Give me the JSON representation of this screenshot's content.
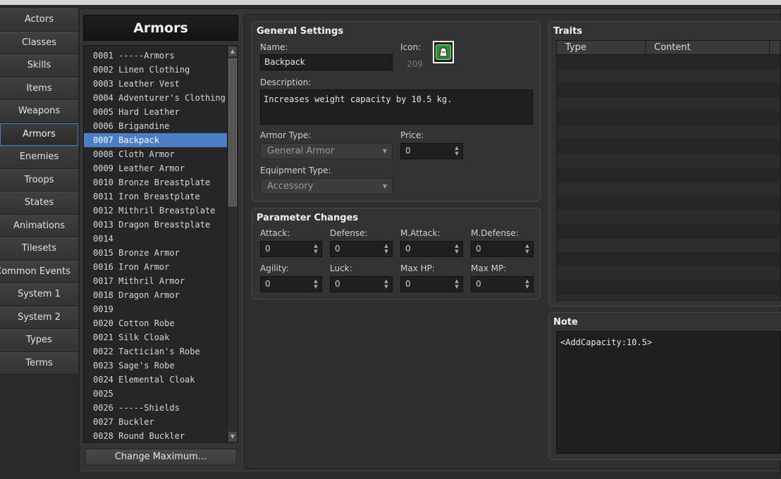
{
  "tabs": [
    {
      "label": "Actors"
    },
    {
      "label": "Classes"
    },
    {
      "label": "Skills"
    },
    {
      "label": "Items"
    },
    {
      "label": "Weapons"
    },
    {
      "label": "Armors"
    },
    {
      "label": "Enemies"
    },
    {
      "label": "Troops"
    },
    {
      "label": "States"
    },
    {
      "label": "Animations"
    },
    {
      "label": "Tilesets"
    },
    {
      "label": "Common Events"
    },
    {
      "label": "System 1"
    },
    {
      "label": "System 2"
    },
    {
      "label": "Types"
    },
    {
      "label": "Terms"
    }
  ],
  "list": {
    "title": "Armors",
    "items": [
      "0001 -----Armors",
      "0002 Linen Clothing",
      "0003 Leather Vest",
      "0004 Adventurer's Clothing",
      "0005 Hard Leather",
      "0006 Brigandine",
      "0007 Backpack",
      "0008 Cloth Armor",
      "0009 Leather Armor",
      "0010 Bronze Breastplate",
      "0011 Iron Breastplate",
      "0012 Mithril Breastplate",
      "0013 Dragon Breastplate",
      "0014",
      "0015 Bronze Armor",
      "0016 Iron Armor",
      "0017 Mithril Armor",
      "0018 Dragon Armor",
      "0019",
      "0020 Cotton Robe",
      "0021 Silk Cloak",
      "0022 Tactician's Robe",
      "0023 Sage's Robe",
      "0024 Elemental Cloak",
      "0025",
      "0026 -----Shields",
      "0027 Buckler",
      "0028 Round Buckler"
    ],
    "change_max_label": "Change Maximum..."
  },
  "general": {
    "title": "General Settings",
    "name_label": "Name:",
    "name_value": "Backpack",
    "icon_label": "Icon:",
    "icon_index": "209",
    "icon_name": "backpack-icon",
    "description_label": "Description:",
    "description_value": "Increases weight capacity by 10.5 kg.",
    "armor_type_label": "Armor Type:",
    "armor_type_value": "General Armor",
    "price_label": "Price:",
    "price_value": "0",
    "equip_type_label": "Equipment Type:",
    "equip_type_value": "Accessory"
  },
  "params": {
    "title": "Parameter Changes",
    "attack_label": "Attack:",
    "attack_value": "0",
    "defense_label": "Defense:",
    "defense_value": "0",
    "mattack_label": "M.Attack:",
    "mattack_value": "0",
    "mdefense_label": "M.Defense:",
    "mdefense_value": "0",
    "agility_label": "Agility:",
    "agility_value": "0",
    "luck_label": "Luck:",
    "luck_value": "0",
    "maxhp_label": "Max HP:",
    "maxhp_value": "0",
    "maxmp_label": "Max MP:",
    "maxmp_value": "0"
  },
  "traits": {
    "title": "Traits",
    "col_type": "Type",
    "col_content": "Content"
  },
  "note": {
    "title": "Note",
    "value": "<AddCapacity:10.5>"
  },
  "colors": {
    "selection": "#4a7fc7",
    "active_tab_border": "#4b7fbf",
    "icon_green": "#2e8b35"
  }
}
